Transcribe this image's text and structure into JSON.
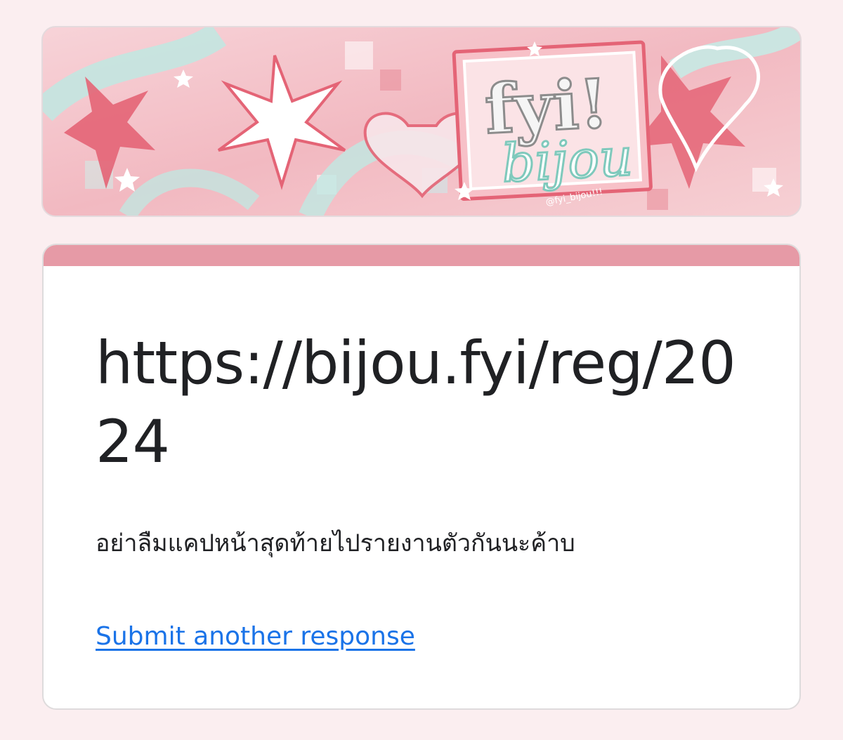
{
  "header": {
    "banner_image": "fyi-bijou-header-graphic",
    "logo_text": "fyi!",
    "logo_script": "bijou",
    "logo_handle": "@fyi_bijou!!!"
  },
  "form": {
    "title": "https://bijou.fyi/reg/2024",
    "message": "อย่าลืมแคปหน้าสุดท้ายไปรายงานตัวกันนะค้าบ",
    "submit_another_label": "Submit another response"
  },
  "colors": {
    "page_background": "#fbeef0",
    "accent_bar": "#e69aa6",
    "link": "#1a73e8",
    "text": "#202124"
  }
}
